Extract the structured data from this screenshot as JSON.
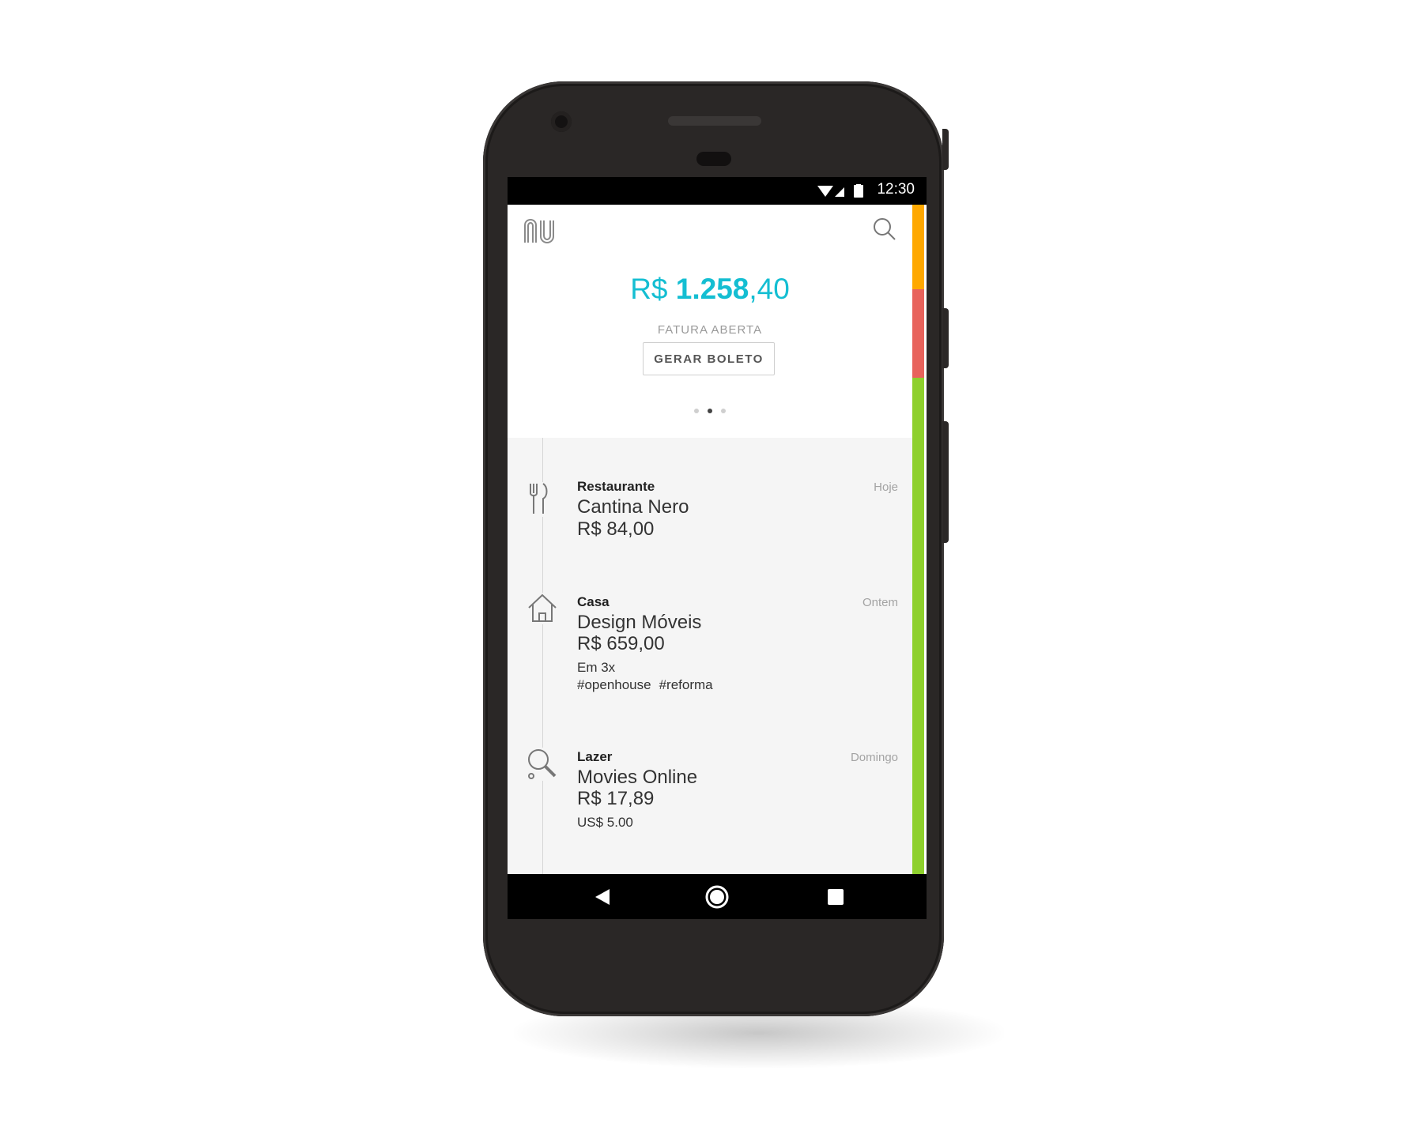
{
  "statusbar": {
    "time": "12:30"
  },
  "header": {
    "balance_prefix": "R$ ",
    "balance_bold": "1.258",
    "balance_cents": ",40",
    "subtitle": "FATURA ABERTA",
    "button_label": "GERAR BOLETO",
    "page_indicator": {
      "count": 3,
      "active": 2
    }
  },
  "transactions": [
    {
      "category": "Restaurante",
      "date": "Hoje",
      "merchant": "Cantina Nero",
      "amount": "R$ 84,00",
      "icon": "fork-knife-icon"
    },
    {
      "category": "Casa",
      "date": "Ontem",
      "merchant": "Design Móveis",
      "amount": "R$ 659,00",
      "installments": "Em 3x",
      "tags": [
        "#openhouse",
        "#reforma"
      ],
      "icon": "house-icon"
    },
    {
      "category": "Lazer",
      "date": "Domingo",
      "merchant": "Movies Online",
      "amount": "R$ 17,89",
      "foreign_amount": "US$ 5.00",
      "icon": "ping-pong-icon"
    }
  ],
  "colors": {
    "accent": "#14bed2",
    "limit_bar": [
      "#ffa800",
      "#e8635c",
      "#8ed02d"
    ]
  }
}
